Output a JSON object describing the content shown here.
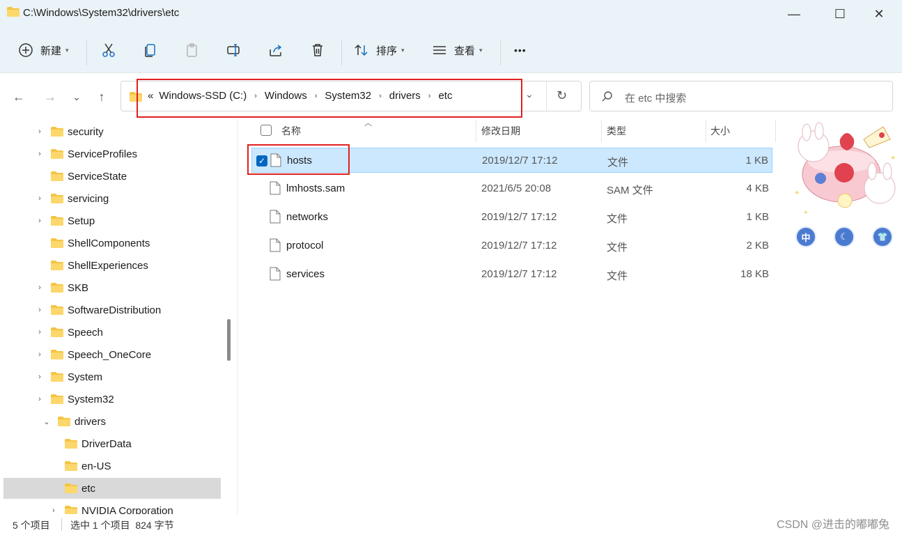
{
  "window": {
    "title": "C:\\Windows\\System32\\drivers\\etc",
    "minimize_glyph": "—",
    "maximize_glyph": "☐",
    "close_glyph": "✕"
  },
  "toolbar": {
    "new_label": "新建",
    "sort_label": "排序",
    "view_label": "查看",
    "more_label": "•••",
    "icons": [
      "plus-circle-icon",
      "cut-icon",
      "copy-icon",
      "paste-icon",
      "rename-icon",
      "share-icon",
      "delete-icon",
      "sort-icon",
      "view-icon",
      "more-icon"
    ]
  },
  "navigation": {
    "back": "←",
    "forward": "→",
    "recent": "⌄",
    "up": "↑",
    "overflow": "«",
    "breadcrumbs": [
      "Windows-SSD (C:)",
      "Windows",
      "System32",
      "drivers",
      "etc"
    ],
    "refresh": "↻",
    "dropdown": "⌄"
  },
  "search": {
    "placeholder": "在 etc 中搜索"
  },
  "sidebar": {
    "items": [
      {
        "label": "security",
        "expandable": true,
        "level": 0
      },
      {
        "label": "ServiceProfiles",
        "expandable": true,
        "level": 0
      },
      {
        "label": "ServiceState",
        "expandable": false,
        "level": 0
      },
      {
        "label": "servicing",
        "expandable": true,
        "level": 0
      },
      {
        "label": "Setup",
        "expandable": true,
        "level": 0
      },
      {
        "label": "ShellComponents",
        "expandable": false,
        "level": 0
      },
      {
        "label": "ShellExperiences",
        "expandable": false,
        "level": 0
      },
      {
        "label": "SKB",
        "expandable": true,
        "level": 0
      },
      {
        "label": "SoftwareDistribution",
        "expandable": true,
        "level": 0
      },
      {
        "label": "Speech",
        "expandable": true,
        "level": 0
      },
      {
        "label": "Speech_OneCore",
        "expandable": true,
        "level": 0
      },
      {
        "label": "System",
        "expandable": true,
        "level": 0
      },
      {
        "label": "System32",
        "expandable": true,
        "level": 0
      },
      {
        "label": "drivers",
        "expandable": true,
        "expanded": true,
        "level": 1
      },
      {
        "label": "DriverData",
        "expandable": false,
        "level": 2
      },
      {
        "label": "en-US",
        "expandable": false,
        "level": 2
      },
      {
        "label": "etc",
        "expandable": false,
        "level": 2,
        "selected": true
      },
      {
        "label": "NVIDIA Corporation",
        "expandable": true,
        "level": 2
      }
    ]
  },
  "columns": {
    "name": "名称",
    "date": "修改日期",
    "type": "类型",
    "size": "大小"
  },
  "files": [
    {
      "name": "hosts",
      "date": "2019/12/7 17:12",
      "type": "文件",
      "size": "1 KB",
      "selected": true
    },
    {
      "name": "lmhosts.sam",
      "date": "2021/6/5 20:08",
      "type": "SAM 文件",
      "size": "4 KB"
    },
    {
      "name": "networks",
      "date": "2019/12/7 17:12",
      "type": "文件",
      "size": "1 KB"
    },
    {
      "name": "protocol",
      "date": "2019/12/7 17:12",
      "type": "文件",
      "size": "2 KB"
    },
    {
      "name": "services",
      "date": "2019/12/7 17:12",
      "type": "文件",
      "size": "18 KB"
    }
  ],
  "sticker": {
    "buttons": [
      "中",
      "☾",
      "👕"
    ]
  },
  "status": {
    "count": "5 个项目",
    "selection": "选中 1 个项目  824 字节"
  },
  "watermark": "CSDN @进击的嘟嘟兔",
  "colors": {
    "accent": "#0067c0",
    "selected_row": "#cce8ff",
    "highlight_box": "#e02020",
    "folder": "#f4c542"
  }
}
